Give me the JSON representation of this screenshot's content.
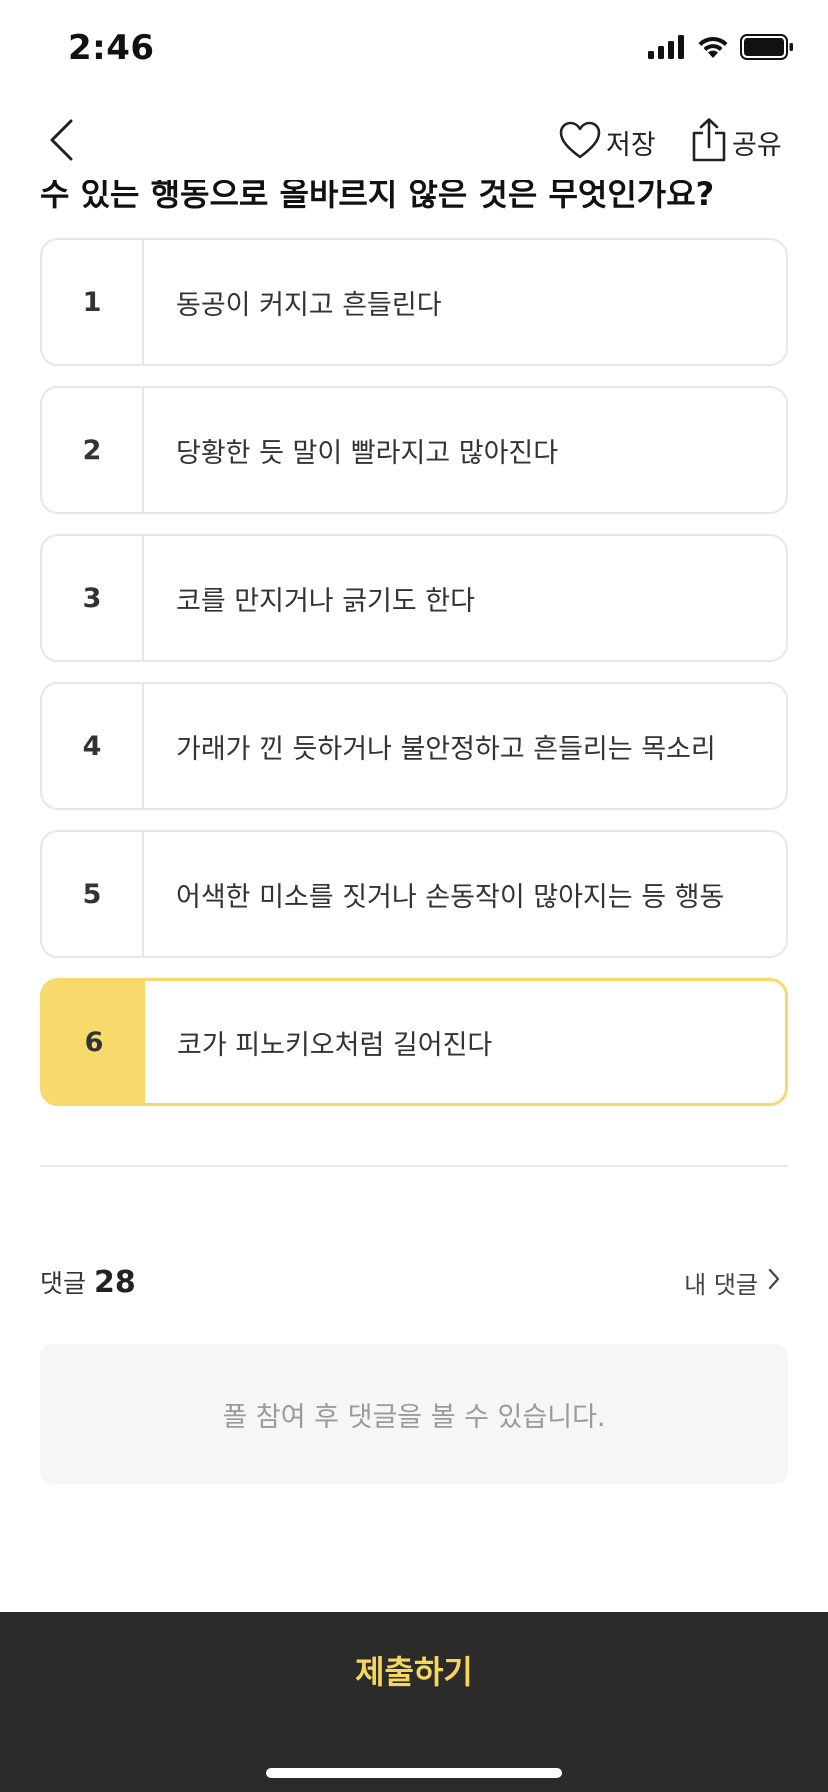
{
  "status_bar": {
    "time": "2:46",
    "icons": [
      "signal-icon",
      "wifi-icon",
      "battery-icon"
    ]
  },
  "nav": {
    "back_icon": "chevron-left-icon",
    "save_icon": "heart-icon",
    "save_label": "저장",
    "share_icon": "share-icon",
    "share_label": "공유"
  },
  "question": {
    "visible_text": "수 있는 행동으로 올바르지 않은 것은 무엇인가요?"
  },
  "options": [
    {
      "number": "1",
      "text": "동공이 커지고 흔들린다",
      "selected": false
    },
    {
      "number": "2",
      "text": "당황한 듯 말이 빨라지고 많아진다",
      "selected": false
    },
    {
      "number": "3",
      "text": "코를 만지거나 긁기도 한다",
      "selected": false
    },
    {
      "number": "4",
      "text": "가래가 낀 듯하거나 불안정하고 흔들리는 목소리",
      "selected": false
    },
    {
      "number": "5",
      "text": "어색한 미소를 짓거나 손동작이 많아지는 등 행동",
      "selected": false
    },
    {
      "number": "6",
      "text": "코가 피노키오처럼 길어진다",
      "selected": true
    }
  ],
  "comments": {
    "label": "댓글",
    "count": "28",
    "my_comments_label": "내 댓글",
    "my_comments_icon": "chevron-right-icon",
    "locked_message": "폴 참여 후 댓글을 볼 수 있습니다."
  },
  "submit": {
    "label": "제출하기"
  },
  "colors": {
    "accent": "#f7da6b",
    "submit_text": "#f7d65e",
    "bottom_bar": "#2b2b2b",
    "border": "#e6e6e6"
  }
}
